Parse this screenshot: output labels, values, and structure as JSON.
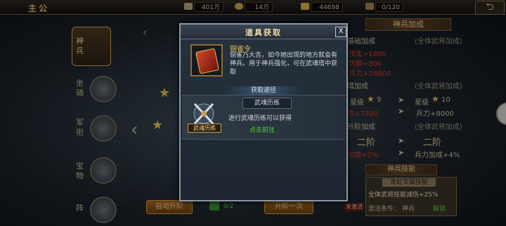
{
  "topbar": {
    "logo_text": "主公",
    "resources": [
      {
        "icon": "token-icon",
        "value": "401万"
      },
      {
        "icon": "coin-icon",
        "value": "14万"
      },
      {
        "icon": "ingot-icon",
        "value": "44698"
      },
      {
        "icon": "stamina-icon",
        "value": "0/120"
      }
    ],
    "back_icon": "back-arrow-icon"
  },
  "sidebar": {
    "items": [
      {
        "label": "神兵"
      },
      {
        "label": "坐骑"
      },
      {
        "label": "军衔"
      },
      {
        "label": "宝物"
      },
      {
        "label": "阵"
      }
    ]
  },
  "right_panel": {
    "header": "神兵加成",
    "rows": [
      {
        "left": "基础加成",
        "right": "(全体武将加成)"
      },
      {
        "left": "攻击+1600",
        "right": ""
      },
      {
        "left": "防御+800",
        "right": ""
      },
      {
        "left": "兵力+26600",
        "right": ""
      },
      {
        "left": "增加成",
        "right": "(全体武将加成)"
      }
    ],
    "stars": [
      {
        "label": "星级",
        "value": "9"
      },
      {
        "label": "星级",
        "value": "10"
      }
    ],
    "att_left": "攻+7200",
    "att_right": "兵力+8000",
    "upgrade_header": "升阶加成",
    "upgrade_sub": "(全体武将加成)",
    "tier_left": "二阶",
    "tier_right": "二阶",
    "bonus_left": "加成+2%",
    "bonus_right": "兵力加成+4%",
    "skill_header": "神兵技能",
    "skill_name": "青虹专属技能",
    "skill_desc": "全体武将技能减伤+25%",
    "activate_label": "激活条件：",
    "activate_cond": "神兵",
    "activate_state": "解锁",
    "activate_tag": "未激活"
  },
  "modal": {
    "title": "道具获取",
    "close_label": "X",
    "item_name": "铜雀令",
    "item_desc": "铜雀乃大吉，如今她出现的地方就会有神兵。用于神兵强化，可在武魂塔中获取",
    "source_header": "获取途径",
    "source_name": "武魂历练",
    "source_icon_label": "武魂历练",
    "source_desc": "进行武魂历练可以获得",
    "go_label": "点击前往"
  },
  "bottom": {
    "auto_upgrade": "自动升阶",
    "upgrade_once": "升阶一次",
    "count": "0/2"
  },
  "colors": {
    "gold": "#e8c25a",
    "green": "#51d441",
    "red": "#d4382c"
  }
}
